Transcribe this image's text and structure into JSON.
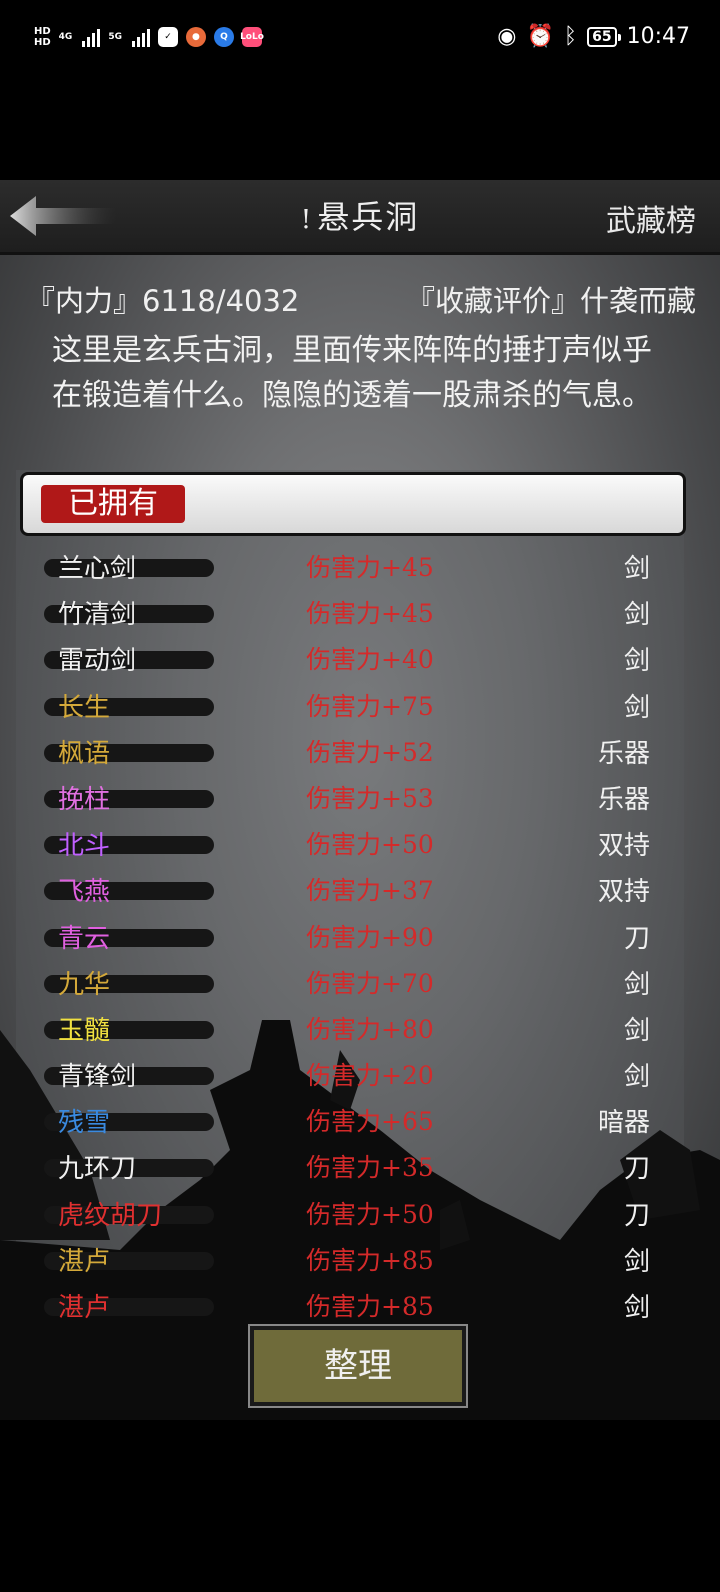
{
  "status_bar": {
    "time": "10:47",
    "battery": "65",
    "network_1": "4G",
    "network_2": "5G",
    "hd_1": "HD",
    "hd_2": "HD",
    "app_icon_last": "LoLo"
  },
  "header": {
    "title": "悬兵洞",
    "title_mark": "!",
    "rank_button": "武藏榜"
  },
  "stats": {
    "neili": "『内力』6118/4032",
    "rating": "『收藏评价』什袭而藏"
  },
  "description": "这里是玄兵古洞，里面传来阵阵的捶打声似乎在锻造着什么。隐隐的透着一股肃杀的气息。",
  "tab": {
    "label": "已拥有",
    "color": "#b01818"
  },
  "items": [
    {
      "name": "兰心剑",
      "damage": "伤害力+45",
      "type": "剑",
      "color": "#f0f0f0"
    },
    {
      "name": "竹清剑",
      "damage": "伤害力+45",
      "type": "剑",
      "color": "#f0f0f0"
    },
    {
      "name": "雷动剑",
      "damage": "伤害力+40",
      "type": "剑",
      "color": "#f0f0f0"
    },
    {
      "name": "长生",
      "damage": "伤害力+75",
      "type": "剑",
      "color": "#d4a93a"
    },
    {
      "name": "枫语",
      "damage": "伤害力+52",
      "type": "乐器",
      "color": "#d4a93a"
    },
    {
      "name": "挽柱",
      "damage": "伤害力+53",
      "type": "乐器",
      "color": "#e070e0"
    },
    {
      "name": "北斗",
      "damage": "伤害力+50",
      "type": "双持",
      "color": "#c060ff"
    },
    {
      "name": "飞燕",
      "damage": "伤害力+37",
      "type": "双持",
      "color": "#e060e0"
    },
    {
      "name": "青云",
      "damage": "伤害力+90",
      "type": "刀",
      "color": "#e060e0"
    },
    {
      "name": "九华",
      "damage": "伤害力+70",
      "type": "剑",
      "color": "#d4a93a"
    },
    {
      "name": "玉髓",
      "damage": "伤害力+80",
      "type": "剑",
      "color": "#f0e040"
    },
    {
      "name": "青锋剑",
      "damage": "伤害力+20",
      "type": "剑",
      "color": "#f0f0f0"
    },
    {
      "name": "残雪",
      "damage": "伤害力+65",
      "type": "暗器",
      "color": "#3a8ae0"
    },
    {
      "name": "九环刀",
      "damage": "伤害力+35",
      "type": "刀",
      "color": "#f0f0f0"
    },
    {
      "name": "虎纹胡刀",
      "damage": "伤害力+50",
      "type": "刀",
      "color": "#e03030"
    },
    {
      "name": "湛卢",
      "damage": "伤害力+85",
      "type": "剑",
      "color": "#d4a93a"
    },
    {
      "name": "湛卢",
      "damage": "伤害力+85",
      "type": "剑",
      "color": "#e03030"
    }
  ],
  "sort_button": "整理"
}
